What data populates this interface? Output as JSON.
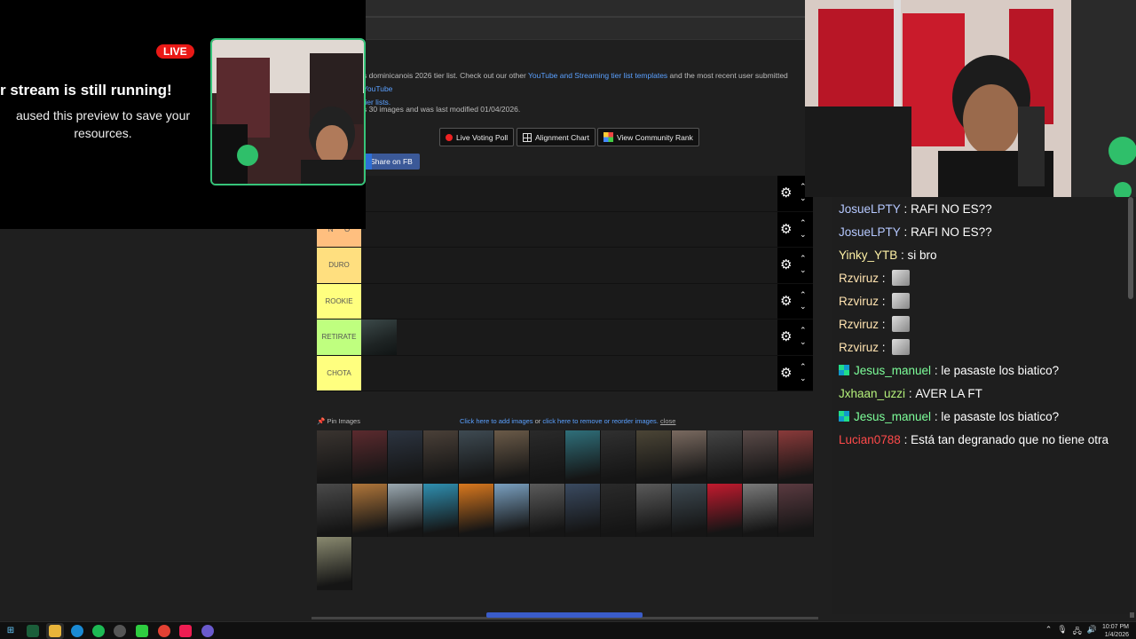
{
  "site": {
    "intro_start": "s dominicanois 2026 tier list. Check out our other ",
    "intro_link1": "YouTube and Streaming tier list templates",
    "intro_mid": " and the most recent user submitted ",
    "intro_link2": "YouTube",
    "intro_link2_cont": "tier lists.",
    "modified": "s 30 images and was last modified 01/04/2026.",
    "buttons": {
      "live_voting": "Live Voting Poll",
      "alignment": "Alignment Chart",
      "community": "View Community Rank",
      "share": "Share on FB"
    }
  },
  "tiers": [
    {
      "label": "",
      "color": "#1a1a1a"
    },
    {
      "label": "N****O",
      "color": "#ffbf7f"
    },
    {
      "label": "DURO",
      "color": "#ffdf7f"
    },
    {
      "label": "ROOKIE",
      "color": "#ffff7f"
    },
    {
      "label": "RETIRATE",
      "color": "#bfff7f"
    },
    {
      "label": "CHOTA",
      "color": "#ffff7f"
    }
  ],
  "pool": {
    "pin_label": "Pin Images",
    "add_link": "Click here to add images",
    "or_text": " or ",
    "remove_link": "click here to remove or reorder images.",
    "close": "close",
    "count": 29
  },
  "stream_overlay": {
    "live": "LIVE",
    "message_line1": "r stream is still running!",
    "message_line2": "aused this preview to save your resources."
  },
  "chat": [
    {
      "user": "JosueLPTY",
      "color": "#b5c8ff",
      "text": "RAFI NO ES??",
      "emote": false,
      "badge": false
    },
    {
      "user": "JosueLPTY",
      "color": "#b5c8ff",
      "text": "RAFI NO ES??",
      "emote": false,
      "badge": false
    },
    {
      "user": "Yinky_YTB",
      "color": "#fff2a6",
      "text": "si bro",
      "emote": false,
      "badge": false
    },
    {
      "user": "Rzviruz",
      "color": "#ffe3b0",
      "text": "",
      "emote": true,
      "badge": false
    },
    {
      "user": "Rzviruz",
      "color": "#ffe3b0",
      "text": "",
      "emote": true,
      "badge": false
    },
    {
      "user": "Rzviruz",
      "color": "#ffe3b0",
      "text": "",
      "emote": true,
      "badge": false
    },
    {
      "user": "Rzviruz",
      "color": "#ffe3b0",
      "text": "",
      "emote": true,
      "badge": false
    },
    {
      "user": "Jesus_manuel",
      "color": "#7dff9a",
      "text": "le pasaste los biatico?",
      "emote": false,
      "badge": true
    },
    {
      "user": "Jxhaan_uzzi",
      "color": "#b4f07a",
      "text": "AVER LA FT",
      "emote": false,
      "badge": false
    },
    {
      "user": "Jesus_manuel",
      "color": "#7dff9a",
      "text": "le pasaste los biatico?",
      "emote": false,
      "badge": true
    },
    {
      "user": "Lucian0788",
      "color": "#ff4a4a",
      "text": "Está tan degranado que no tiene otra",
      "emote": false,
      "badge": false
    }
  ],
  "taskbar": {
    "time": "10:07 PM",
    "date": "1/4/2026"
  }
}
